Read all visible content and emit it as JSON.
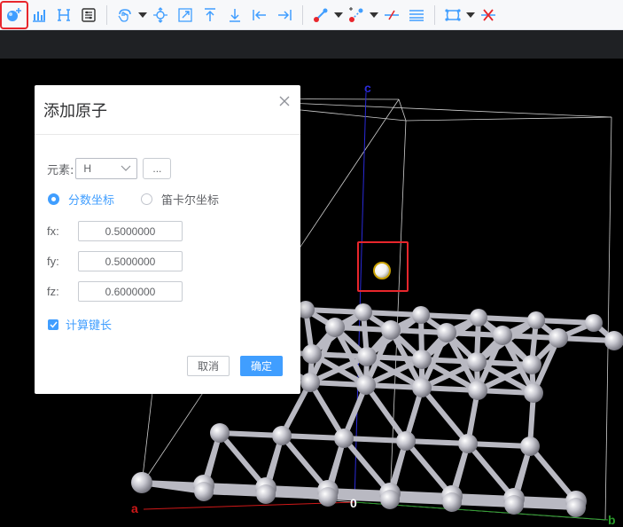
{
  "toolbar": {
    "groups": [
      [
        "add-atom-icon",
        "bar-chart-icon",
        "hkl-icon",
        "list-settings-icon"
      ],
      [
        "rotate-hand-icon",
        "move-center-icon",
        "resize-icon",
        "align-top-icon",
        "align-bottom-icon",
        "align-left-icon",
        "align-right-icon"
      ],
      [
        "bond-icon",
        "bond-edit-icon",
        "bond-cut-icon",
        "bond-lines-icon"
      ],
      [
        "lattice-box-icon",
        "delete-x-icon"
      ]
    ],
    "accent_color": "#409eff",
    "highlight_color": "#e8262c"
  },
  "viewport": {
    "axes": {
      "a": "a",
      "b": "b",
      "c": "c",
      "origin": "0"
    },
    "axis_colors": {
      "a": "#d01818",
      "b": "#2a9a2a",
      "c": "#2a2ad8"
    }
  },
  "dialog": {
    "title": "添加原子",
    "element_label": "元素:",
    "element_value": "H",
    "more_button": "...",
    "radio_fractional": "分数坐标",
    "radio_cartesian": "笛卡尔坐标",
    "selected_coord_mode": "fractional",
    "fields": [
      {
        "label": "fx:",
        "value": "0.5000000"
      },
      {
        "label": "fy:",
        "value": "0.5000000"
      },
      {
        "label": "fz:",
        "value": "0.6000000"
      }
    ],
    "calc_bond_label": "计算键长",
    "calc_bond_checked": true,
    "cancel_label": "取消",
    "ok_label": "确定"
  }
}
